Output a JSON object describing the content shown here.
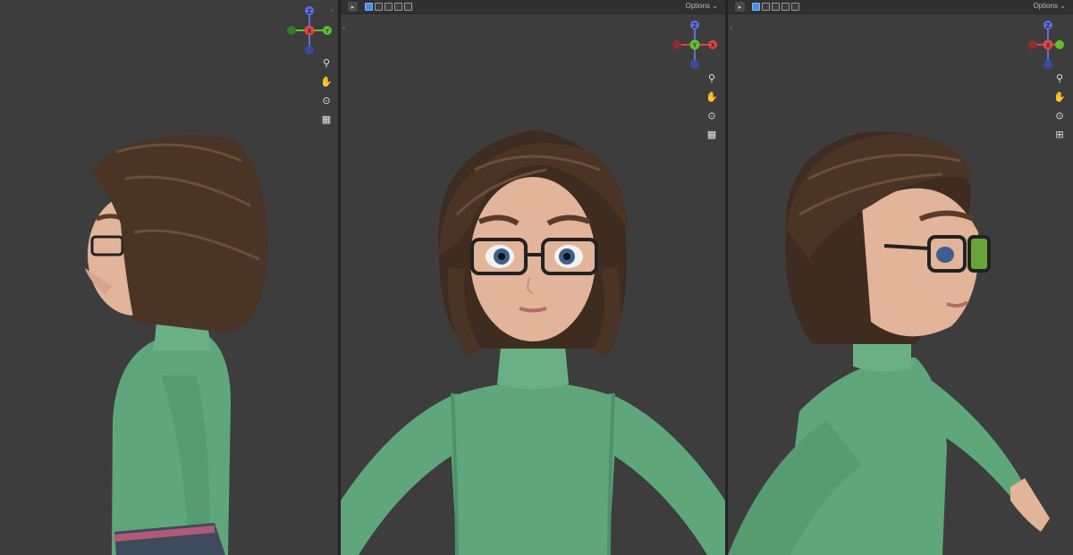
{
  "header": {
    "options_label": "Options"
  },
  "gizmo": {
    "axis_x": "X",
    "axis_y": "Y",
    "axis_z": "Z",
    "color_x": "#e04545",
    "color_y": "#5fc12e",
    "color_z": "#5b6fe0"
  },
  "tools": {
    "zoom": "zoom-icon",
    "pan": "hand-icon",
    "camera": "camera-icon",
    "grid": "grid-icon"
  },
  "colors": {
    "sweater": "#5fa77a",
    "hair": "#4a3426",
    "skin": "#e2b49a",
    "background": "#3d3d3d"
  }
}
